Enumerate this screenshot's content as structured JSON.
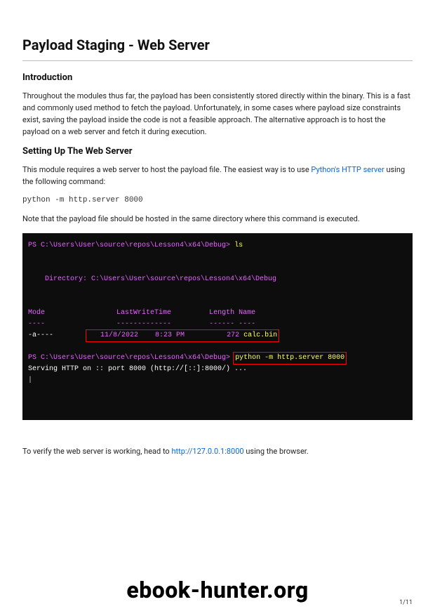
{
  "title": "Payload Staging - Web Server",
  "intro": {
    "heading": "Introduction",
    "body": "Throughout the modules thus far, the payload has been consistently stored directly within the binary. This is a fast and commonly used method to fetch the payload. Unfortunately, in some cases where payload size constraints exist, saving the payload inside the code is not a feasible approach. The alternative approach is to host the payload on a web server and fetch it during execution."
  },
  "section2": {
    "heading": "Setting Up The Web Server",
    "lead_before_link": "This module requires a web server to host the payload file. The easiest way is to use ",
    "link_text": "Python's HTTP server",
    "lead_after_link": " using the following command:",
    "code_line": "python -m http.server 8000",
    "note": "Note that the payload file should be hosted in the same directory where this command is executed."
  },
  "terminal": {
    "ps_prompt1_path": "PS C:\\Users\\User\\source\\repos\\Lesson4\\x64\\Debug> ",
    "ls_cmd": "ls",
    "dir_line": "    Directory: C:\\Users\\User\\source\\repos\\Lesson4\\x64\\Debug",
    "hdr_mode": "Mode",
    "hdr_lastwrite": "LastWriteTime",
    "hdr_length": "Length",
    "hdr_name": "Name",
    "dash_mode": "----",
    "dash_lastwrite": "-------------",
    "dash_length": "------",
    "dash_name": "----",
    "row_mode": "-a----",
    "row_date": "   11/8/2022    8:23 PM          272 ",
    "row_name": "calc.bin",
    "ps_prompt2_path": "PS C:\\Users\\User\\source\\repos\\Lesson4\\x64\\Debug> ",
    "serve_cmd": "python -m http.server 8000",
    "serving_line": "Serving HTTP on :: port 8000 (http://[::]:8000/) ..."
  },
  "verify": {
    "before_link": "To verify the web server is working, head to ",
    "link_text": "http://127.0.0.1:8000",
    "after_link": " using the browser."
  },
  "watermark": "ebook-hunter.org",
  "page_number": "1/11"
}
